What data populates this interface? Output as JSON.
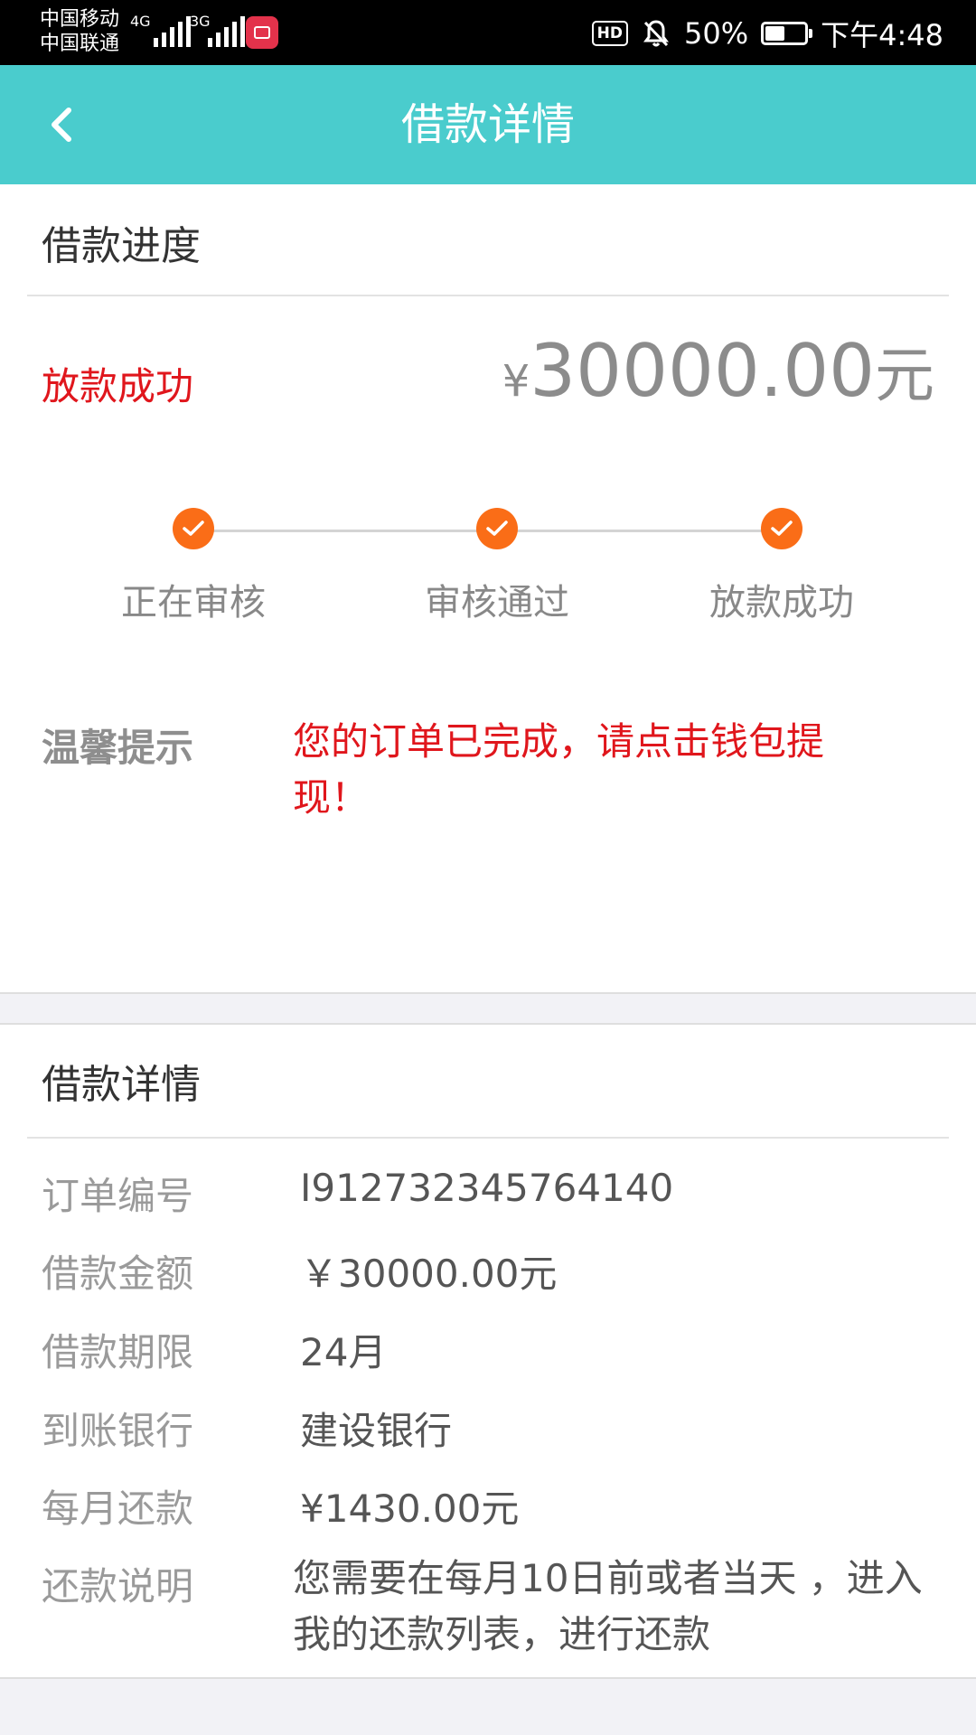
{
  "status_bar": {
    "carrier1": "中国移动",
    "carrier2": "中国联通",
    "net1": "4G",
    "net2": "3G",
    "hd": "HD",
    "battery_text": "50%",
    "battery_level": 0.5,
    "time": "下午4:48",
    "icons": [
      "signal-icon",
      "app-mall-icon",
      "mute-bell-icon",
      "battery-icon"
    ]
  },
  "header": {
    "title": "借款详情",
    "back_icon": "chevron-left-icon",
    "bg_color": "#4acccd"
  },
  "progress_section": {
    "title": "借款进度",
    "status": "放款成功",
    "amount": {
      "currency": "¥",
      "value": "30000.00",
      "unit": "元"
    },
    "steps": [
      "正在审核",
      "审核通过",
      "放款成功"
    ],
    "steps_done": 3,
    "tip_label": "温馨提示",
    "tip_text": "您的订单已完成，请点击钱包提现！"
  },
  "detail_section": {
    "title": "借款详情",
    "rows": [
      {
        "label": "订单编号",
        "value": "I912732345764140"
      },
      {
        "label": "借款金额",
        "value": "￥30000.00元"
      },
      {
        "label": "借款期限",
        "value": "24月"
      },
      {
        "label": "到账银行",
        "value": "建设银行"
      },
      {
        "label": "每月还款",
        "value": "¥1430.00元"
      },
      {
        "label": "还款说明",
        "value": "您需要在每月10日前或者当天 ，进入我的还款列表，进行还款"
      }
    ]
  },
  "colors": {
    "accent": "#4acccd",
    "status_red": "#e0161c",
    "step_orange": "#fa6d17"
  }
}
